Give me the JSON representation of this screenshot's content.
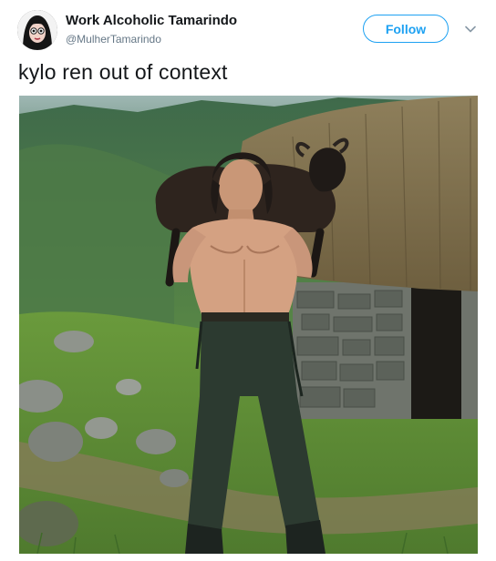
{
  "author": {
    "display_name": "Work Alcoholic Tamarindo",
    "handle": "@MulherTamarindo",
    "avatar_icon": "avatar-icon"
  },
  "actions": {
    "follow_label": "Follow",
    "menu_icon": "chevron-down-icon"
  },
  "tweet": {
    "text": "kylo ren out of context"
  },
  "colors": {
    "accent": "#1da1f2",
    "name": "#14171a",
    "handle": "#657786"
  }
}
